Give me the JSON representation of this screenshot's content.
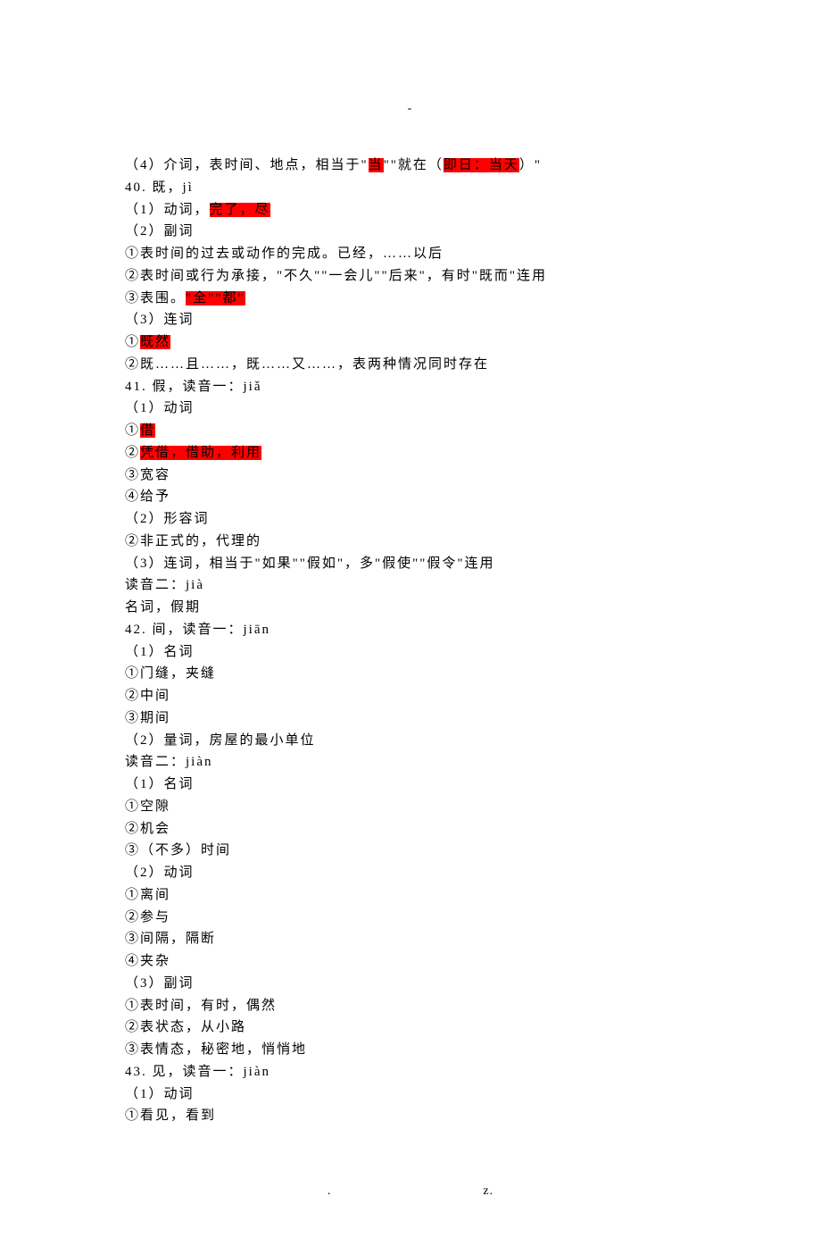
{
  "header": {
    "dash": "-"
  },
  "lines": [
    {
      "segs": [
        {
          "t": "（4）介词，表时间、地点，相当于\""
        },
        {
          "t": "当",
          "hl": true
        },
        {
          "t": "\"\"就在（"
        },
        {
          "t": "即日：当天",
          "hl": true
        },
        {
          "t": "）\""
        }
      ]
    },
    {
      "segs": [
        {
          "t": "40. 既，jì"
        }
      ]
    },
    {
      "segs": [
        {
          "t": "（1）动词，"
        },
        {
          "t": "完了，尽",
          "hl": true
        }
      ]
    },
    {
      "segs": [
        {
          "t": "（2）副词"
        }
      ]
    },
    {
      "segs": [
        {
          "t": "①表时间的过去或动作的完成。已经，……以后"
        }
      ]
    },
    {
      "segs": [
        {
          "t": "②表时间或行为承接，\"不久\"\"一会儿\"\"后来\"，有时\"既而\"连用"
        }
      ]
    },
    {
      "segs": [
        {
          "t": "③表围。"
        },
        {
          "t": "\"全\"\"都\"",
          "hl": true
        }
      ]
    },
    {
      "segs": [
        {
          "t": "（3）连词"
        }
      ]
    },
    {
      "segs": [
        {
          "t": "①"
        },
        {
          "t": "既然",
          "hl": true
        }
      ]
    },
    {
      "segs": [
        {
          "t": "②既……且……，既……又……，表两种情况同时存在"
        }
      ]
    },
    {
      "segs": [
        {
          "t": "41. 假，读音一：jiǎ"
        }
      ]
    },
    {
      "segs": [
        {
          "t": "（1）动词"
        }
      ]
    },
    {
      "segs": [
        {
          "t": "①"
        },
        {
          "t": "借",
          "hl": true
        }
      ]
    },
    {
      "segs": [
        {
          "t": "②"
        },
        {
          "t": "凭借，借助，利用",
          "hl": true
        }
      ]
    },
    {
      "segs": [
        {
          "t": "③宽容"
        }
      ]
    },
    {
      "segs": [
        {
          "t": "④给予"
        }
      ]
    },
    {
      "segs": [
        {
          "t": "（2）形容词"
        }
      ]
    },
    {
      "segs": [
        {
          "t": "②非正式的，代理的"
        }
      ]
    },
    {
      "segs": [
        {
          "t": "（3）连词，相当于\"如果\"\"假如\"，多\"假使\"\"假令\"连用"
        }
      ]
    },
    {
      "segs": [
        {
          "t": "读音二：jià"
        }
      ]
    },
    {
      "segs": [
        {
          "t": "名词，假期"
        }
      ]
    },
    {
      "segs": [
        {
          "t": "42. 间，读音一：jiān"
        }
      ]
    },
    {
      "segs": [
        {
          "t": "（1）名词"
        }
      ]
    },
    {
      "segs": [
        {
          "t": "①门缝，夹缝"
        }
      ]
    },
    {
      "segs": [
        {
          "t": "②中间"
        }
      ]
    },
    {
      "segs": [
        {
          "t": "③期间"
        }
      ]
    },
    {
      "segs": [
        {
          "t": "（2）量词，房屋的最小单位"
        }
      ]
    },
    {
      "segs": [
        {
          "t": "读音二：jiàn"
        }
      ]
    },
    {
      "segs": [
        {
          "t": "（1）名词"
        }
      ]
    },
    {
      "segs": [
        {
          "t": "①空隙"
        }
      ]
    },
    {
      "segs": [
        {
          "t": "②机会"
        }
      ]
    },
    {
      "segs": [
        {
          "t": "③（不多）时间"
        }
      ]
    },
    {
      "segs": [
        {
          "t": "（2）动词"
        }
      ]
    },
    {
      "segs": [
        {
          "t": "①离间"
        }
      ]
    },
    {
      "segs": [
        {
          "t": "②参与"
        }
      ]
    },
    {
      "segs": [
        {
          "t": "③间隔，隔断"
        }
      ]
    },
    {
      "segs": [
        {
          "t": "④夹杂"
        }
      ]
    },
    {
      "segs": [
        {
          "t": "（3）副词"
        }
      ]
    },
    {
      "segs": [
        {
          "t": "①表时间，有时，偶然"
        }
      ]
    },
    {
      "segs": [
        {
          "t": "②表状态，从小路"
        }
      ]
    },
    {
      "segs": [
        {
          "t": "③表情态，秘密地，悄悄地"
        }
      ]
    },
    {
      "segs": [
        {
          "t": "43. 见，读音一：jiàn"
        }
      ]
    },
    {
      "segs": [
        {
          "t": "（1）动词"
        }
      ]
    },
    {
      "segs": [
        {
          "t": "①看见，看到"
        }
      ]
    }
  ],
  "footer": {
    "left": ".",
    "right": "z."
  }
}
